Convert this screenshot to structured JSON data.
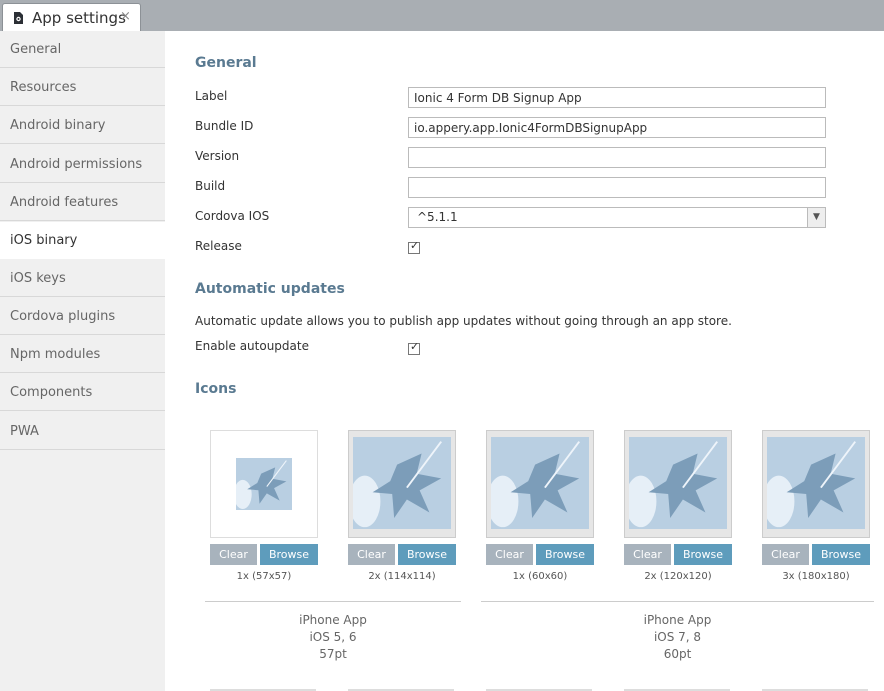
{
  "tab": {
    "title": "App settings",
    "close": "×"
  },
  "sidebar": {
    "items": [
      {
        "label": "General"
      },
      {
        "label": "Resources"
      },
      {
        "label": "Android binary"
      },
      {
        "label": "Android permissions"
      },
      {
        "label": "Android features"
      },
      {
        "label": "iOS binary",
        "active": true
      },
      {
        "label": "iOS keys"
      },
      {
        "label": "Cordova plugins"
      },
      {
        "label": "Npm modules"
      },
      {
        "label": "Components"
      },
      {
        "label": "PWA"
      }
    ]
  },
  "general": {
    "title": "General",
    "label_label": "Label",
    "label_value": "Ionic 4 Form DB Signup App",
    "bundle_label": "Bundle ID",
    "bundle_value": "io.appery.app.Ionic4FormDBSignupApp",
    "version_label": "Version",
    "version_value": "",
    "build_label": "Build",
    "build_value": "",
    "cordova_label": "Cordova IOS",
    "cordova_value": "^5.1.1",
    "release_label": "Release",
    "release_checked": true
  },
  "updates": {
    "title": "Automatic updates",
    "description": "Automatic update allows you to publish app updates without going through an app store.",
    "enable_label": "Enable autoupdate",
    "enable_checked": true
  },
  "icons": {
    "title": "Icons",
    "clear_label": "Clear",
    "browse_label": "Browse",
    "items": [
      {
        "size": "1x (57x57)"
      },
      {
        "size": "2x (114x114)"
      },
      {
        "size": "1x (60x60)"
      },
      {
        "size": "2x (120x120)"
      },
      {
        "size": "3x (180x180)"
      }
    ],
    "groups": [
      {
        "line1": "iPhone App",
        "line2": "iOS 5, 6",
        "line3": "57pt"
      },
      {
        "line1": "iPhone App",
        "line2": "iOS 7, 8",
        "line3": "60pt"
      }
    ]
  },
  "colors": {
    "accent": "#5e9cbc",
    "heading": "#5a7a91",
    "clear_button": "#a8b3bd"
  }
}
